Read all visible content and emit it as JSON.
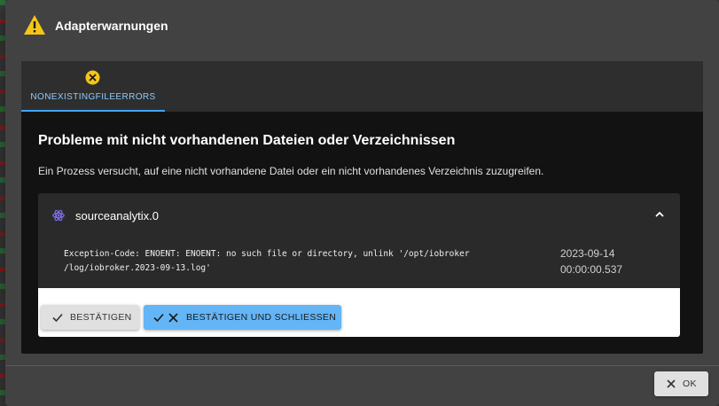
{
  "dialog": {
    "title": "Adapterwarnungen",
    "title_icon": "warning-triangle-icon",
    "accent_color": "#f5c518"
  },
  "tabs": [
    {
      "label": "NONEXISTINGFILEERRORS",
      "icon": "error-circle-icon",
      "active": true
    }
  ],
  "main": {
    "heading": "Probleme mit nicht vorhandenen Dateien oder Verzeichnissen",
    "description": "Ein Prozess versucht, auf eine nicht vorhandene Datei oder ein nicht vorhandenes Verzeichnis zuzugreifen."
  },
  "warning_card": {
    "adapter": "sourceanalytix.0",
    "adapter_icon": "adapter-icon",
    "message_line1": "Exception-Code: ENOENT: ENOENT: no such file or directory, unlink '/opt/iobroker",
    "message_line2": "/log/iobroker.2023-09-13.log'",
    "date": "2023-09-14",
    "time": "00:00:00.537",
    "expanded": true
  },
  "buttons": {
    "confirm": "BESTÄTIGEN",
    "confirm_close": "BESTÄTIGEN UND SCHLIESSEN",
    "ok": "OK"
  },
  "colors": {
    "primary": "#64b5f6",
    "tab_active": "#42a5f5",
    "warning": "#f5c518"
  }
}
